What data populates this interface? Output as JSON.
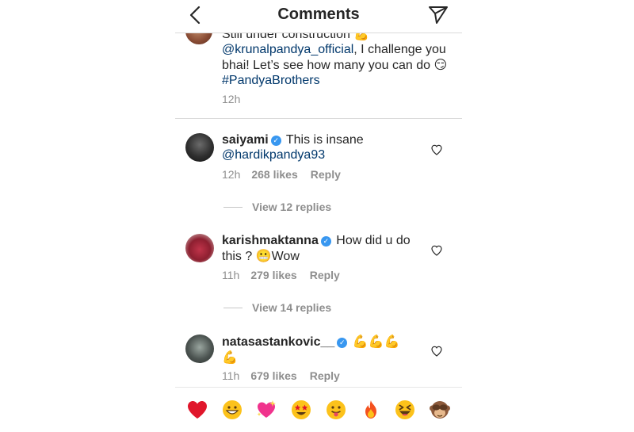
{
  "header": {
    "title": "Comments"
  },
  "caption": {
    "line1": "Still under construction ",
    "mention": "@krunalpandya_official",
    "text": ", I challenge you bhai! Let’s see how many you can do ",
    "hashtag": "#PandyaBrothers",
    "time": "12h"
  },
  "comments": [
    {
      "username": "saiyami",
      "text": "This is insane ",
      "mention": "@hardikpandya93",
      "time": "12h",
      "likes": "268 likes",
      "reply": "Reply",
      "view_replies": "View 12 replies"
    },
    {
      "username": "karishmaktanna",
      "text": "How did u do this ? ",
      "text2": "Wow",
      "time": "11h",
      "likes": "279 likes",
      "reply": "Reply",
      "view_replies": "View 14 replies"
    },
    {
      "username": "natasastankovic__",
      "time": "11h",
      "likes": "679 likes",
      "reply": "Reply"
    }
  ],
  "icons": {
    "back": "chevron-left-icon",
    "send": "paper-plane-icon",
    "like": "heart-outline-icon",
    "verified": "verified-badge-icon"
  },
  "emoji_bar": [
    "red-heart",
    "grinning-face",
    "sparkling-heart",
    "star-struck",
    "tongue-face",
    "fire",
    "laughing-face",
    "see-no-evil-monkey"
  ],
  "colors": {
    "link": "#00376b",
    "verified": "#3897f0",
    "meta": "#8e8e8e"
  }
}
